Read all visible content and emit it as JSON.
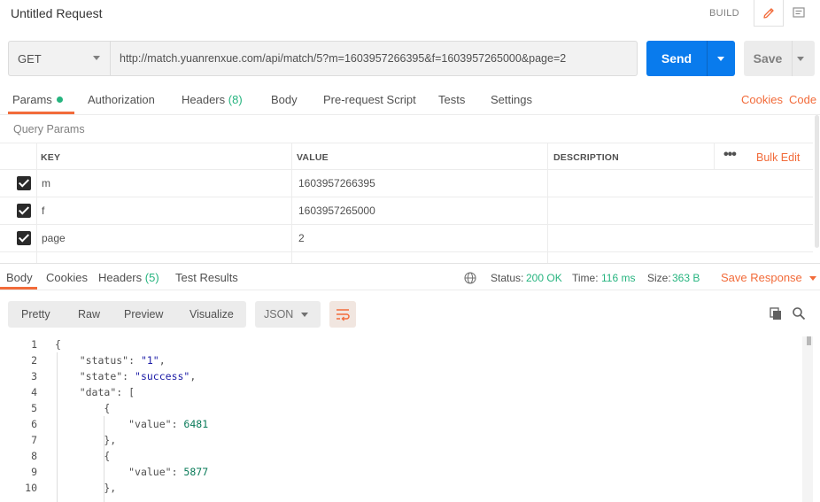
{
  "header": {
    "title": "Untitled Request",
    "mode_label": "BUILD"
  },
  "request": {
    "method": "GET",
    "url": "http://match.yuanrenxue.com/api/match/5?m=1603957266395&f=1603957265000&page=2",
    "send_label": "Send",
    "save_label": "Save"
  },
  "tabs": {
    "params": "Params",
    "authorization": "Authorization",
    "headers": "Headers",
    "headers_count": "(8)",
    "body": "Body",
    "prerequest": "Pre-request Script",
    "tests": "Tests",
    "settings": "Settings",
    "cookies": "Cookies",
    "code": "Code"
  },
  "query_params": {
    "title": "Query Params",
    "columns": {
      "key": "KEY",
      "value": "VALUE",
      "description": "DESCRIPTION"
    },
    "more": "•••",
    "bulk_edit": "Bulk Edit",
    "rows": [
      {
        "key": "m",
        "value": "1603957266395",
        "description": "",
        "checked": true
      },
      {
        "key": "f",
        "value": "1603957265000",
        "description": "",
        "checked": true
      },
      {
        "key": "page",
        "value": "2",
        "description": "",
        "checked": true
      }
    ]
  },
  "response": {
    "tabs": {
      "body": "Body",
      "cookies": "Cookies",
      "headers": "Headers",
      "headers_count": "(5)",
      "test_results": "Test Results"
    },
    "status_label": "Status:",
    "status_value": "200 OK",
    "time_label": "Time:",
    "time_value": "116 ms",
    "size_label": "Size:",
    "size_value": "363 B",
    "save_response": "Save Response",
    "views": {
      "pretty": "Pretty",
      "raw": "Raw",
      "preview": "Preview",
      "visualize": "Visualize"
    },
    "format": "JSON",
    "code_lines": [
      {
        "n": "1",
        "text": "{"
      },
      {
        "n": "2",
        "text": "    \"status\": \"1\","
      },
      {
        "n": "3",
        "text": "    \"state\": \"success\","
      },
      {
        "n": "4",
        "text": "    \"data\": ["
      },
      {
        "n": "5",
        "text": "        {"
      },
      {
        "n": "6",
        "text": "            \"value\": 6481"
      },
      {
        "n": "7",
        "text": "        },"
      },
      {
        "n": "8",
        "text": "        {"
      },
      {
        "n": "9",
        "text": "            \"value\": 5877"
      },
      {
        "n": "10",
        "text": "        },"
      }
    ]
  },
  "colors": {
    "accent": "#f26b3a",
    "send": "#097bed",
    "success": "#26b47f"
  },
  "icons": [
    "pencil-icon",
    "comment-icon",
    "globe-icon",
    "wrap-lines-icon",
    "copy-icon",
    "search-icon",
    "dropdown-caret-icon",
    "checkbox-checked-icon"
  ]
}
